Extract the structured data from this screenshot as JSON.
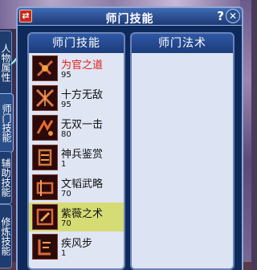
{
  "window": {
    "title": "师门技能",
    "help_label": "?",
    "close_label": "✕",
    "menu_label": "⇄"
  },
  "side_tabs": {
    "attributes": "人物属性",
    "shimen": "师门技能",
    "assist": "辅助技能",
    "cultivation": "修炼技能"
  },
  "panels": {
    "skills_header": "师门技能",
    "spells_header": "师门法术"
  },
  "skills": [
    {
      "name": "为官之道",
      "level": "95",
      "icon": "official-way-icon",
      "highlight": false,
      "red": true
    },
    {
      "name": "十方无敌",
      "level": "95",
      "icon": "crossed-blades-icon",
      "highlight": false,
      "red": false
    },
    {
      "name": "无双一击",
      "level": "80",
      "icon": "strike-icon",
      "highlight": false,
      "red": false
    },
    {
      "name": "神兵鉴赏",
      "level": "1",
      "icon": "weapon-appraisal-icon",
      "highlight": false,
      "red": false
    },
    {
      "name": "文韬武略",
      "level": "70",
      "icon": "strategy-icon",
      "highlight": false,
      "red": false
    },
    {
      "name": "紫薇之术",
      "level": "70",
      "icon": "ziwei-art-icon",
      "highlight": true,
      "red": false
    },
    {
      "name": "疾风步",
      "level": "1",
      "icon": "swift-step-icon",
      "highlight": false,
      "red": false
    }
  ],
  "colors": {
    "window_bg": "#0e2a5a",
    "panel_bg": "#dfe5f3",
    "header_bg": "#1c3c7c",
    "selected_row": "#d6dc74",
    "red_name": "#e0201a"
  }
}
